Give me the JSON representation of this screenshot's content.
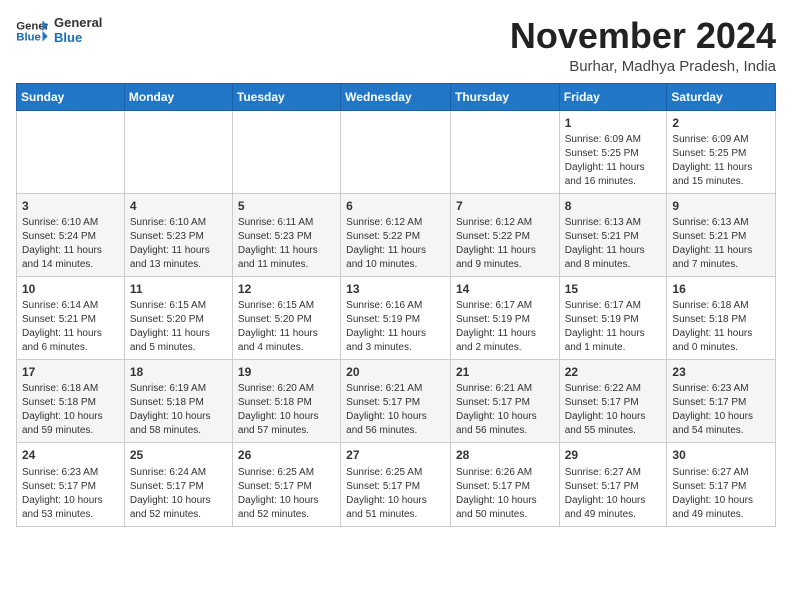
{
  "header": {
    "logo_general": "General",
    "logo_blue": "Blue",
    "title": "November 2024",
    "location": "Burhar, Madhya Pradesh, India"
  },
  "weekdays": [
    "Sunday",
    "Monday",
    "Tuesday",
    "Wednesday",
    "Thursday",
    "Friday",
    "Saturday"
  ],
  "weeks": [
    [
      {
        "day": "",
        "info": ""
      },
      {
        "day": "",
        "info": ""
      },
      {
        "day": "",
        "info": ""
      },
      {
        "day": "",
        "info": ""
      },
      {
        "day": "",
        "info": ""
      },
      {
        "day": "1",
        "info": "Sunrise: 6:09 AM\nSunset: 5:25 PM\nDaylight: 11 hours and 16 minutes."
      },
      {
        "day": "2",
        "info": "Sunrise: 6:09 AM\nSunset: 5:25 PM\nDaylight: 11 hours and 15 minutes."
      }
    ],
    [
      {
        "day": "3",
        "info": "Sunrise: 6:10 AM\nSunset: 5:24 PM\nDaylight: 11 hours and 14 minutes."
      },
      {
        "day": "4",
        "info": "Sunrise: 6:10 AM\nSunset: 5:23 PM\nDaylight: 11 hours and 13 minutes."
      },
      {
        "day": "5",
        "info": "Sunrise: 6:11 AM\nSunset: 5:23 PM\nDaylight: 11 hours and 11 minutes."
      },
      {
        "day": "6",
        "info": "Sunrise: 6:12 AM\nSunset: 5:22 PM\nDaylight: 11 hours and 10 minutes."
      },
      {
        "day": "7",
        "info": "Sunrise: 6:12 AM\nSunset: 5:22 PM\nDaylight: 11 hours and 9 minutes."
      },
      {
        "day": "8",
        "info": "Sunrise: 6:13 AM\nSunset: 5:21 PM\nDaylight: 11 hours and 8 minutes."
      },
      {
        "day": "9",
        "info": "Sunrise: 6:13 AM\nSunset: 5:21 PM\nDaylight: 11 hours and 7 minutes."
      }
    ],
    [
      {
        "day": "10",
        "info": "Sunrise: 6:14 AM\nSunset: 5:21 PM\nDaylight: 11 hours and 6 minutes."
      },
      {
        "day": "11",
        "info": "Sunrise: 6:15 AM\nSunset: 5:20 PM\nDaylight: 11 hours and 5 minutes."
      },
      {
        "day": "12",
        "info": "Sunrise: 6:15 AM\nSunset: 5:20 PM\nDaylight: 11 hours and 4 minutes."
      },
      {
        "day": "13",
        "info": "Sunrise: 6:16 AM\nSunset: 5:19 PM\nDaylight: 11 hours and 3 minutes."
      },
      {
        "day": "14",
        "info": "Sunrise: 6:17 AM\nSunset: 5:19 PM\nDaylight: 11 hours and 2 minutes."
      },
      {
        "day": "15",
        "info": "Sunrise: 6:17 AM\nSunset: 5:19 PM\nDaylight: 11 hours and 1 minute."
      },
      {
        "day": "16",
        "info": "Sunrise: 6:18 AM\nSunset: 5:18 PM\nDaylight: 11 hours and 0 minutes."
      }
    ],
    [
      {
        "day": "17",
        "info": "Sunrise: 6:18 AM\nSunset: 5:18 PM\nDaylight: 10 hours and 59 minutes."
      },
      {
        "day": "18",
        "info": "Sunrise: 6:19 AM\nSunset: 5:18 PM\nDaylight: 10 hours and 58 minutes."
      },
      {
        "day": "19",
        "info": "Sunrise: 6:20 AM\nSunset: 5:18 PM\nDaylight: 10 hours and 57 minutes."
      },
      {
        "day": "20",
        "info": "Sunrise: 6:21 AM\nSunset: 5:17 PM\nDaylight: 10 hours and 56 minutes."
      },
      {
        "day": "21",
        "info": "Sunrise: 6:21 AM\nSunset: 5:17 PM\nDaylight: 10 hours and 56 minutes."
      },
      {
        "day": "22",
        "info": "Sunrise: 6:22 AM\nSunset: 5:17 PM\nDaylight: 10 hours and 55 minutes."
      },
      {
        "day": "23",
        "info": "Sunrise: 6:23 AM\nSunset: 5:17 PM\nDaylight: 10 hours and 54 minutes."
      }
    ],
    [
      {
        "day": "24",
        "info": "Sunrise: 6:23 AM\nSunset: 5:17 PM\nDaylight: 10 hours and 53 minutes."
      },
      {
        "day": "25",
        "info": "Sunrise: 6:24 AM\nSunset: 5:17 PM\nDaylight: 10 hours and 52 minutes."
      },
      {
        "day": "26",
        "info": "Sunrise: 6:25 AM\nSunset: 5:17 PM\nDaylight: 10 hours and 52 minutes."
      },
      {
        "day": "27",
        "info": "Sunrise: 6:25 AM\nSunset: 5:17 PM\nDaylight: 10 hours and 51 minutes."
      },
      {
        "day": "28",
        "info": "Sunrise: 6:26 AM\nSunset: 5:17 PM\nDaylight: 10 hours and 50 minutes."
      },
      {
        "day": "29",
        "info": "Sunrise: 6:27 AM\nSunset: 5:17 PM\nDaylight: 10 hours and 49 minutes."
      },
      {
        "day": "30",
        "info": "Sunrise: 6:27 AM\nSunset: 5:17 PM\nDaylight: 10 hours and 49 minutes."
      }
    ]
  ]
}
